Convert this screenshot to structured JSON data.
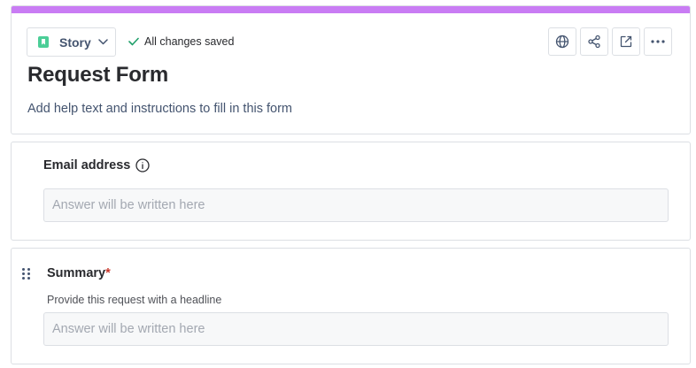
{
  "theme": {
    "accent": "#c97cf4",
    "story_icon_color": "#4bce97",
    "check_color": "#22a06b",
    "required_color": "#c9372c"
  },
  "header": {
    "issue_type_label": "Story",
    "save_status": "All changes saved",
    "tools": [
      "globe-icon",
      "share-icon",
      "open-external-icon",
      "more-icon"
    ]
  },
  "form": {
    "title": "Request Form",
    "help_text": "Add help text and instructions to fill in this form"
  },
  "fields": [
    {
      "label": "Email address",
      "placeholder": "Answer will be written here",
      "has_info_icon": true
    },
    {
      "label": "Summary",
      "required_marker": "*",
      "description": "Provide this request with a headline",
      "placeholder": "Answer will be written here"
    }
  ]
}
